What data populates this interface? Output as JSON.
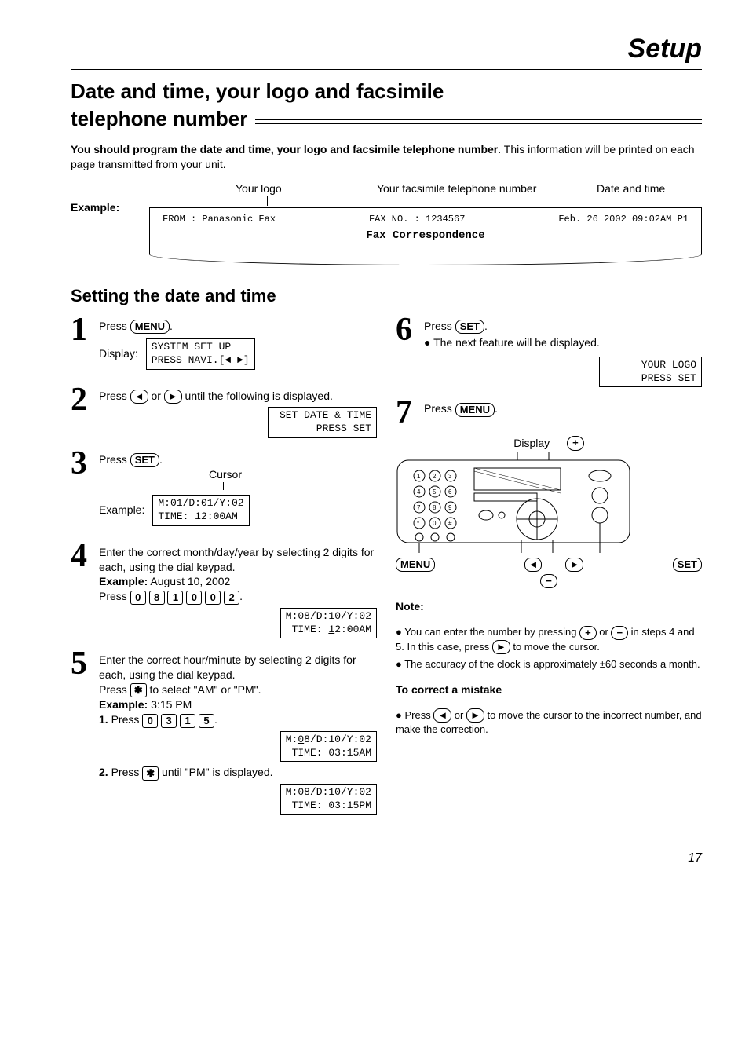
{
  "page_title": "Setup",
  "heading": "Date and time, your logo and facsimile telephone number",
  "intro_bold": "You should program the date and time, your logo and facsimile telephone number",
  "intro_rest": ". This information will be printed on each page transmitted from your unit.",
  "example_label": "Example:",
  "callouts": {
    "logo": "Your logo",
    "faxno": "Your facsimile telephone number",
    "datetime": "Date and time"
  },
  "fax_header": {
    "from": "FROM : Panasonic Fax",
    "faxno": "FAX NO. : 1234567",
    "date": "Feb. 26 2002 09:02AM  P1",
    "title": "Fax Correspondence"
  },
  "subheading": "Setting the date and time",
  "buttons": {
    "menu": "MENU",
    "set": "SET",
    "left": "◄",
    "right": "►",
    "plus": "+",
    "minus": "−",
    "star": "✱",
    "d0": "0",
    "d1": "1",
    "d2": "2",
    "d3": "3",
    "d5": "5",
    "d8": "8"
  },
  "steps": {
    "s1": {
      "text_a": "Press ",
      "text_b": ".",
      "display_label": "Display:",
      "lcd": "SYSTEM SET UP\nPRESS NAVI.[◄ ►]"
    },
    "s2": {
      "text_a": "Press ",
      "text_mid": " or ",
      "text_b": " until the following is displayed.",
      "lcd": " SET DATE & TIME\n     PRESS SET"
    },
    "s3": {
      "text_a": "Press ",
      "text_b": ".",
      "cursor_label": "Cursor",
      "example_label": "Example:",
      "lcd_pre": "M:",
      "lcd_cur": "0",
      "lcd_post": "1/D:01/Y:02\nTIME: 12:00AM"
    },
    "s4": {
      "text": "Enter the correct month/day/year by selecting 2 digits for each, using the dial keypad.",
      "ex_label": "Example:",
      "ex_val": "  August 10, 2002",
      "press": "Press ",
      "dot": ".",
      "lcd": "M:08/D:10/Y:02\nTIME: 12:00AM",
      "lcd_cur_idx": "1"
    },
    "s5": {
      "text": "Enter the correct hour/minute by selecting 2 digits for each, using the dial keypad.",
      "text2a": "Press ",
      "text2b": " to select \"AM\" or \"PM\".",
      "ex_label": "Example:",
      "ex_val": "  3:15 PM",
      "l1_label": "1.",
      "l1_press": " Press ",
      "l1_dot": ".",
      "lcd1_a": "M:",
      "lcd1_cur": "0",
      "lcd1_b": "8/D:10/Y:02\nTIME: 03:15AM",
      "l2_label": "2.",
      "l2a": " Press ",
      "l2b": " until \"PM\" is displayed.",
      "lcd2_a": "M:",
      "lcd2_cur": "0",
      "lcd2_b": "8/D:10/Y:02\nTIME: 03:15PM"
    },
    "s6": {
      "text_a": "Press ",
      "text_b": ".",
      "bullet": "The next feature will be displayed.",
      "lcd": "     YOUR LOGO\n      PRESS SET"
    },
    "s7": {
      "text_a": "Press ",
      "text_b": "."
    }
  },
  "device_labels": {
    "display": "Display",
    "menu": "MENU",
    "set": "SET"
  },
  "note_heading": "Note:",
  "note1a": "You can enter the number by pressing ",
  "note1b": " or ",
  "note1c": " in steps 4 and 5. In this case, press ",
  "note1d": " to move the cursor.",
  "note2": "The accuracy of the clock is approximately ±60 seconds a month.",
  "correct_heading": "To correct a mistake",
  "correct_a": "Press ",
  "correct_mid": " or ",
  "correct_b": " to move the cursor to the incorrect number, and make the correction.",
  "page_number": "17"
}
